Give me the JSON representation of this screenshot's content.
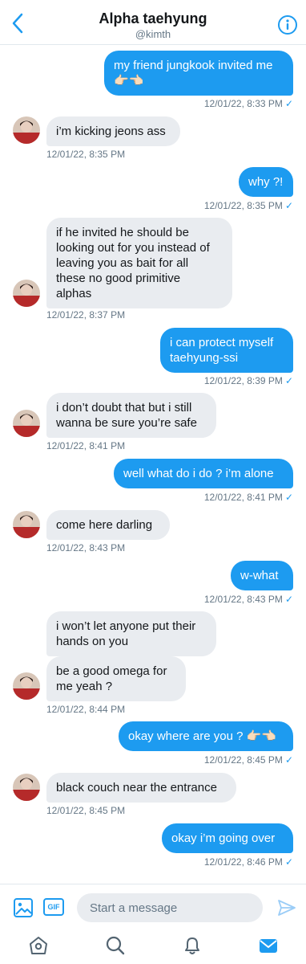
{
  "header": {
    "title": "Alpha taehyung",
    "handle": "@kimth"
  },
  "messages": [
    {
      "dir": "out",
      "lines": [
        "my friend jungkook invited me",
        "👉🏻👈🏻"
      ],
      "time": "12/01/22, 8:33 PM"
    },
    {
      "dir": "in",
      "lines": [
        "i’m kicking jeons ass"
      ],
      "time": "12/01/22, 8:35 PM"
    },
    {
      "dir": "out",
      "lines": [
        "why ?!"
      ],
      "time": "12/01/22, 8:35 PM"
    },
    {
      "dir": "in",
      "lines": [
        "if he invited he should be",
        "looking out for you instead of",
        "leaving you as bait for all",
        "these no good primitive",
        "alphas"
      ],
      "time": "12/01/22, 8:37 PM"
    },
    {
      "dir": "out",
      "lines": [
        "i can protect myself",
        "taehyung-ssi"
      ],
      "time": "12/01/22, 8:39 PM"
    },
    {
      "dir": "in",
      "lines": [
        "i don’t doubt that but i still",
        "wanna be sure you’re safe"
      ],
      "time": "12/01/22, 8:41 PM"
    },
    {
      "dir": "out",
      "lines": [
        "well what do i do ? i’m alone"
      ],
      "time": "12/01/22, 8:41 PM"
    },
    {
      "dir": "in",
      "lines": [
        "come here darling"
      ],
      "time": "12/01/22, 8:43 PM"
    },
    {
      "dir": "out",
      "lines": [
        "w-what"
      ],
      "time": "12/01/22, 8:43 PM"
    },
    {
      "dir": "in",
      "lines": [
        "i won’t let anyone put their",
        "hands on you"
      ],
      "time": ""
    },
    {
      "dir": "in",
      "lines": [
        "be a good omega for",
        "me yeah ?"
      ],
      "time": "12/01/22, 8:44 PM"
    },
    {
      "dir": "out",
      "lines": [
        "okay where are you ? 👉🏻👈🏻"
      ],
      "time": "12/01/22, 8:45 PM"
    },
    {
      "dir": "in",
      "lines": [
        "black couch near the entrance"
      ],
      "time": "12/01/22, 8:45 PM"
    },
    {
      "dir": "out",
      "lines": [
        "okay i’m going over"
      ],
      "time": "12/01/22, 8:46 PM"
    }
  ],
  "composer": {
    "placeholder": "Start a message",
    "gif_label": "GIF"
  },
  "icons": {
    "back": "chevron-left-icon",
    "info": "info-icon",
    "image": "image-icon",
    "send": "send-icon",
    "home": "home-icon",
    "search": "search-icon",
    "notifications": "bell-icon",
    "messages": "mail-icon"
  },
  "colors": {
    "accent": "#1d9bf0",
    "incoming_bubble": "#e9ecf0",
    "meta_text": "#657786"
  }
}
